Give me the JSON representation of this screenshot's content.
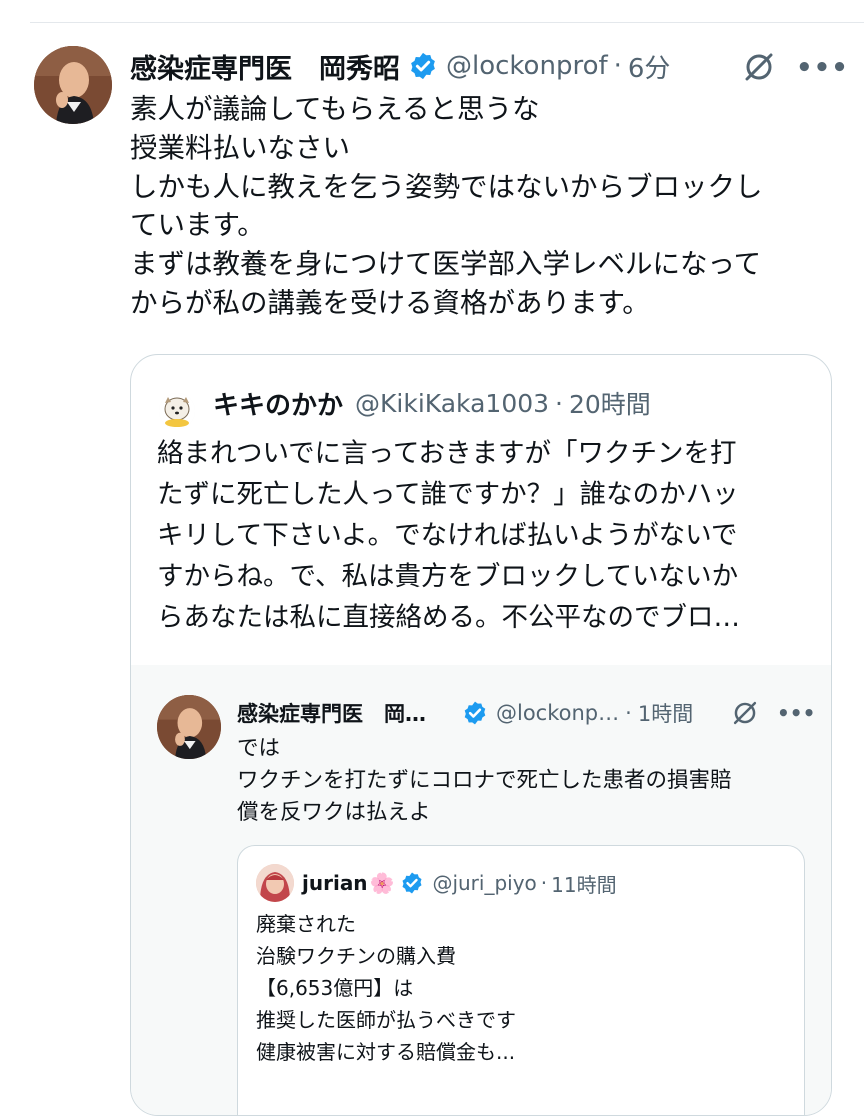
{
  "main_tweet": {
    "author_name": "感染症専門医　岡秀昭",
    "handle": "@lockonprof",
    "separator": "·",
    "time": "6分",
    "lines": [
      "素人が議論してもらえると思うな",
      "授業料払いなさい",
      "しかも人に教えを乞う姿勢ではないからブロックし",
      "ています。",
      "まずは教養を身につけて医学部入学レベルになって",
      "からが私の講義を受ける資格があります。"
    ]
  },
  "quoted_tweet": {
    "author_name": "キキのかか",
    "handle": "@KikiKaka1003",
    "separator": "·",
    "time": "20時間",
    "lines": [
      "絡まれついでに言っておきますが「ワクチンを打",
      "たずに死亡した人って誰ですか？」誰なのかハッ",
      "キリして下さいよ。でなければ払いようがないで",
      "すからね。で、私は貴方をブロックしていないか",
      "らあなたは私に直接絡める。不公平なのでブロ…"
    ]
  },
  "inner_quoted_tweet": {
    "author_name": "感染症専門医　岡…",
    "handle": "@lockonp…",
    "separator": "·",
    "time": "1時間",
    "lines": [
      "では",
      "ワクチンを打たずにコロナで死亡した患者の損害賠",
      "償を反ワクは払えよ"
    ]
  },
  "nested_quoted_tweet": {
    "author_name": "jurian",
    "name_emoji": "🌸",
    "handle": "@juri_piyo",
    "separator": "·",
    "time": "11時間",
    "lines": [
      "廃棄された",
      "治験ワクチンの購入費",
      "【6,653億円】は",
      "推奨した医師が払うべきです",
      "健康被害に対する賠償金も..."
    ]
  },
  "colors": {
    "text": "#0f1419",
    "secondary": "#536471",
    "verified": "#1d9bf0",
    "border": "#cfd9de",
    "inner_background": "#f7f9f9"
  },
  "icons": {
    "verified": "verified-badge-icon",
    "grok": "grok-icon",
    "more": "more-options-icon"
  }
}
